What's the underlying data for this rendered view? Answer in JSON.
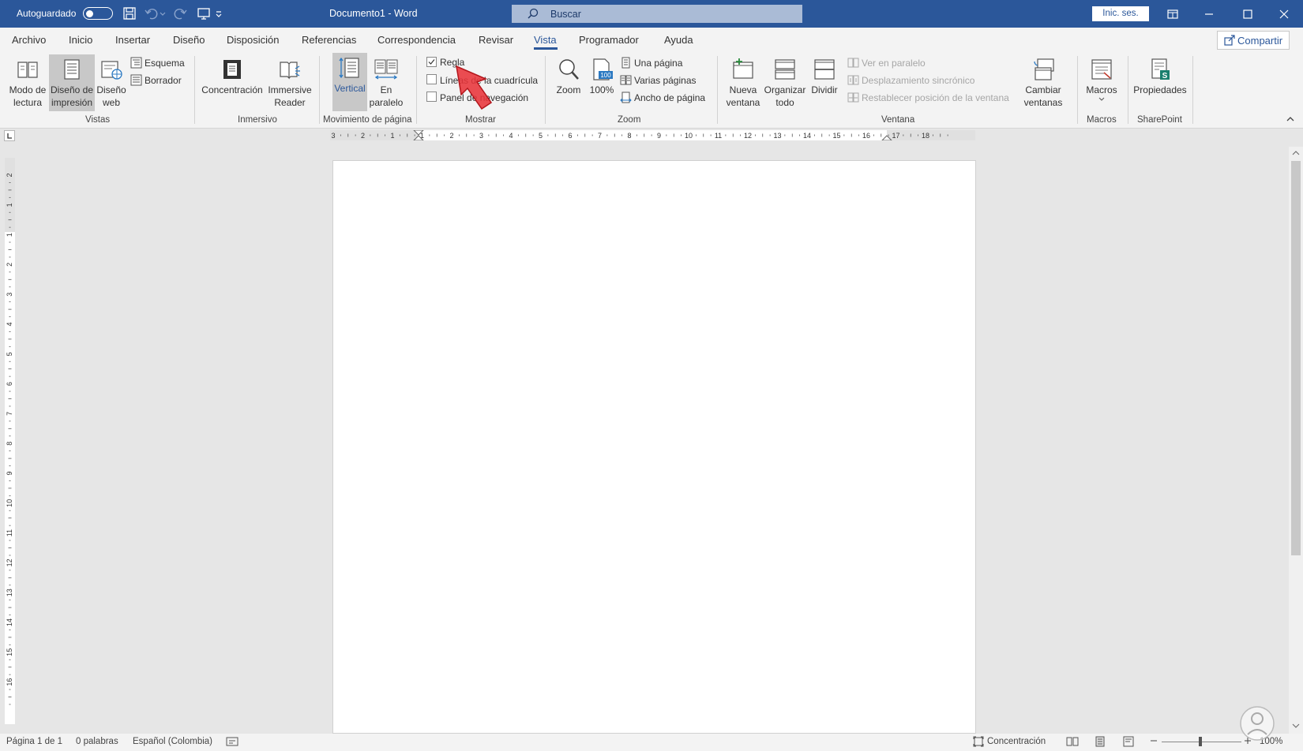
{
  "titlebar": {
    "autosave_label": "Autoguardado",
    "autosave_state": "off",
    "doc_title": "Documento1 - Word",
    "search_placeholder": "Buscar",
    "signin_label": "Inic. ses.",
    "background": "#2b579a"
  },
  "tabs": [
    {
      "label": "Archivo"
    },
    {
      "label": "Inicio"
    },
    {
      "label": "Insertar"
    },
    {
      "label": "Diseño"
    },
    {
      "label": "Disposición"
    },
    {
      "label": "Referencias"
    },
    {
      "label": "Correspondencia"
    },
    {
      "label": "Revisar"
    },
    {
      "label": "Vista",
      "active": true
    },
    {
      "label": "Programador"
    },
    {
      "label": "Ayuda"
    }
  ],
  "share_label": "Compartir",
  "ribbon": {
    "vistas": {
      "group_label": "Vistas",
      "modo_lectura": [
        "Modo de",
        "lectura"
      ],
      "diseno_impresion": [
        "Diseño de",
        "impresión"
      ],
      "diseno_web": [
        "Diseño",
        "web"
      ],
      "esquema": "Esquema",
      "borrador": "Borrador"
    },
    "inmersivo": {
      "group_label": "Inmersivo",
      "concentracion": "Concentración",
      "immersive_reader": [
        "Immersive",
        "Reader"
      ]
    },
    "movimiento": {
      "group_label": "Movimiento de página",
      "vertical": "Vertical",
      "en_paralelo": [
        "En",
        "paralelo"
      ]
    },
    "mostrar": {
      "group_label": "Mostrar",
      "regla": "Regla",
      "regla_checked": true,
      "lineas": "Líneas de la cuadrícula",
      "lineas_checked": false,
      "panel": "Panel de navegación",
      "panel_checked": false
    },
    "zoom": {
      "group_label": "Zoom",
      "zoom": "Zoom",
      "cien": "100%",
      "una_pagina": "Una página",
      "varias_paginas": "Varias páginas",
      "ancho_pagina": "Ancho de página"
    },
    "ventana": {
      "group_label": "Ventana",
      "nueva_ventana": [
        "Nueva",
        "ventana"
      ],
      "organizar_todo": [
        "Organizar",
        "todo"
      ],
      "dividir": "Dividir",
      "ver_paralelo": "Ver en paralelo",
      "desplazamiento": "Desplazamiento sincrónico",
      "restablecer": "Restablecer posición de la ventana",
      "cambiar_ventanas": [
        "Cambiar",
        "ventanas"
      ]
    },
    "macros": {
      "group_label": "Macros",
      "macros": "Macros"
    },
    "sharepoint": {
      "group_label": "SharePoint",
      "propiedades": "Propiedades"
    }
  },
  "ruler": {
    "horizontal_labels": [
      "3",
      "2",
      "1",
      "1",
      "2",
      "3",
      "4",
      "5",
      "6",
      "7",
      "8",
      "9",
      "10",
      "11",
      "12",
      "13",
      "14",
      "15",
      "16",
      "17",
      "18"
    ],
    "vertical_labels": [
      "2",
      "1",
      "1",
      "2",
      "3",
      "4",
      "5",
      "6",
      "7",
      "8",
      "9",
      "10",
      "11",
      "12",
      "13",
      "14",
      "15",
      "16"
    ]
  },
  "statusbar": {
    "page": "Página 1 de 1",
    "words": "0 palabras",
    "language": "Español (Colombia)",
    "focus": "Concentración",
    "zoom": "100%"
  }
}
